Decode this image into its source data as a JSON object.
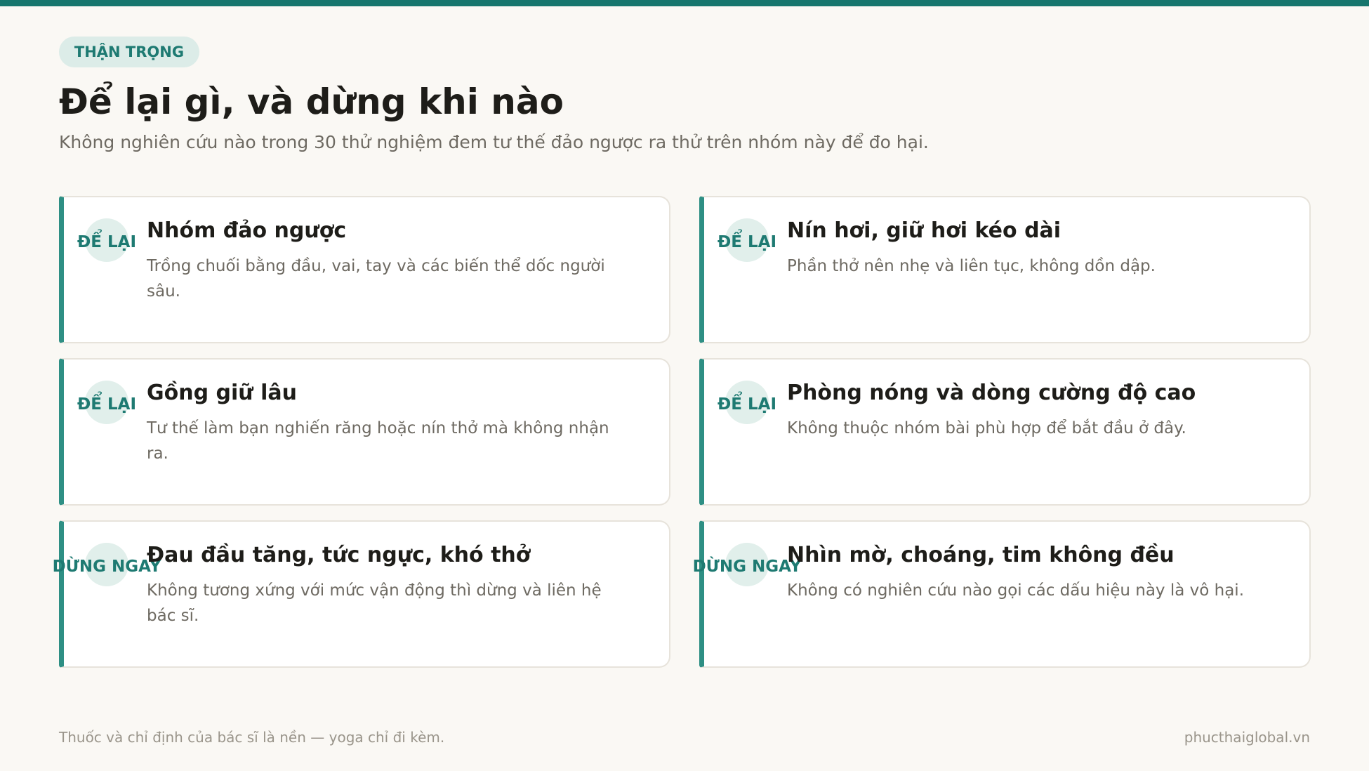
{
  "header": {
    "eyebrow": "THẬN TRỌNG",
    "title": "Để lại gì, và dừng khi nào",
    "subtitle": "Không nghiên cứu nào trong 30 thử nghiệm đem tư thế đảo ngược ra thử trên nhóm này để đo hại."
  },
  "cards": [
    {
      "tag": "ĐỂ LẠI",
      "title": "Nhóm đảo ngược",
      "description": "Trồng chuối bằng đầu, vai, tay và các biến thể dốc người sâu."
    },
    {
      "tag": "ĐỂ LẠI",
      "title": "Nín hơi, giữ hơi kéo dài",
      "description": "Phần thở nên nhẹ và liên tục, không dồn dập."
    },
    {
      "tag": "ĐỂ LẠI",
      "title": "Gồng giữ lâu",
      "description": "Tư thế làm bạn nghiến răng hoặc nín thở mà không nhận ra."
    },
    {
      "tag": "ĐỂ LẠI",
      "title": "Phòng nóng và dòng cường độ cao",
      "description": "Không thuộc nhóm bài phù hợp để bắt đầu ở đây."
    },
    {
      "tag": "DỪNG NGAY",
      "title": "Đau đầu tăng, tức ngực, khó thở",
      "description": "Không tương xứng với mức vận động thì dừng và liên hệ bác sĩ."
    },
    {
      "tag": "DỪNG NGAY",
      "title": "Nhìn mờ, choáng, tim không đều",
      "description": "Không có nghiên cứu nào gọi các dấu hiệu này là vô hại."
    }
  ],
  "footer": {
    "note": "Thuốc và chỉ định của bác sĩ là nền — yoga chỉ đi kèm.",
    "site": "phucthaiglobal.vn"
  },
  "colors": {
    "accent": "#16766d",
    "card_border_accent": "#2e8f84",
    "background": "#faf8f4"
  }
}
